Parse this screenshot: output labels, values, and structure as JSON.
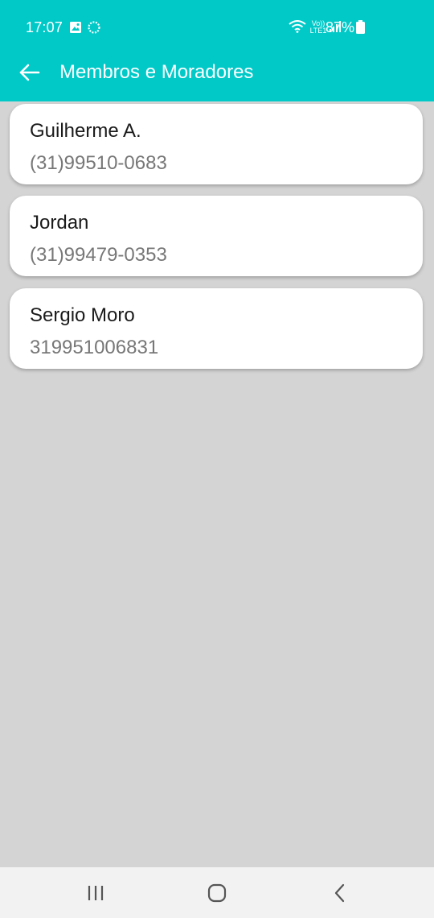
{
  "status_bar": {
    "time": "17:07",
    "battery_percent": "87%",
    "network_label": "Vo)) LTE1"
  },
  "app_bar": {
    "title": "Membros e Moradores",
    "back_icon": "arrow-left-icon"
  },
  "members": [
    {
      "name": "Guilherme A.",
      "phone": "(31)99510-0683"
    },
    {
      "name": "Jordan",
      "phone": "(31)99479-0353"
    },
    {
      "name": "Sergio Moro",
      "phone": "319951006831"
    }
  ],
  "nav_bar": {
    "recent_icon": "recent-apps-icon",
    "home_icon": "home-icon",
    "back_icon": "back-chevron-icon"
  },
  "colors": {
    "accent": "#00c9c8",
    "background": "#d4d4d4",
    "card": "#ffffff"
  }
}
